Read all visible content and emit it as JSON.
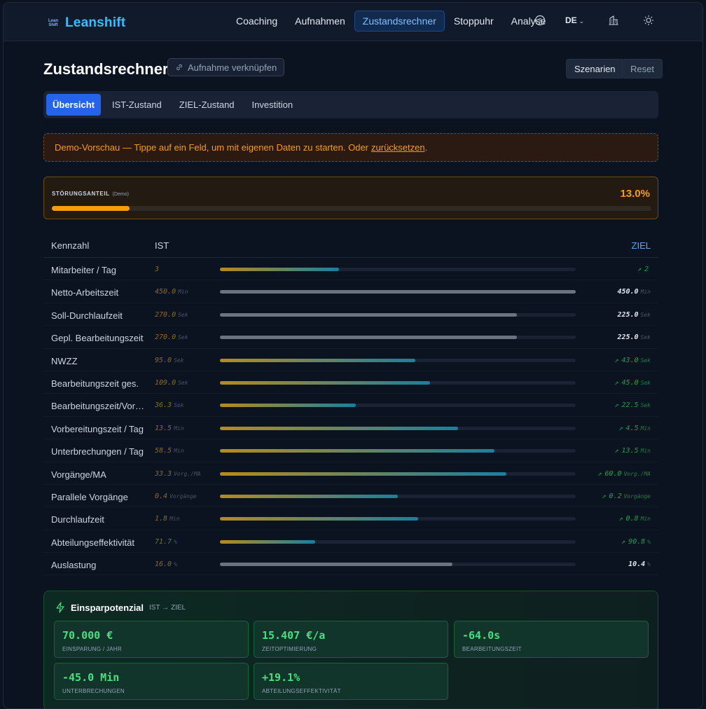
{
  "app": {
    "logo_mark_line1": "Lean",
    "logo_mark_line2": "Shift",
    "name": "Leanshift"
  },
  "nav": {
    "items": [
      "Coaching",
      "Aufnahmen",
      "Zustandsrechner",
      "Stoppuhr",
      "Analyse"
    ],
    "active": "Zustandsrechner",
    "lang": "DE"
  },
  "page": {
    "title": "Zustandsrechner",
    "link_button": "Aufnahme verknüpfen",
    "scenarios_button": "Szenarien",
    "reset_button": "Reset"
  },
  "tabs": [
    "Übersicht",
    "IST-Zustand",
    "ZIEL-Zustand",
    "Investition"
  ],
  "demo_notice": {
    "text": "Demo-Vorschau — Tippe auf ein Feld, um mit eigenen Daten zu starten. Oder",
    "link": "zurücksetzen",
    "suffix": "."
  },
  "stoerung": {
    "label": "STÖRUNGSANTEIL",
    "tag": "(Demo)",
    "value": "13.0%",
    "fraction": 0.13
  },
  "table": {
    "headers": {
      "kennzahl": "Kennzahl",
      "ist": "IST",
      "ziel": "ZIEL"
    },
    "rows": [
      {
        "label": "Mitarbeiter / Tag",
        "ist": "3",
        "ist_unit": "",
        "ziel": "2",
        "ziel_unit": "",
        "improved": true,
        "fill": 0.335
      },
      {
        "label": "Netto-Arbeitszeit",
        "ist": "450.0",
        "ist_unit": "Min",
        "ziel": "450.0",
        "ziel_unit": "Min",
        "improved": false,
        "fill": 1.0
      },
      {
        "label": "Soll-Durchlaufzeit",
        "ist": "270.0",
        "ist_unit": "Sek",
        "ziel": "225.0",
        "ziel_unit": "Sek",
        "improved": false,
        "fill": 0.835
      },
      {
        "label": "Gepl. Bearbeitungszeit",
        "ist": "270.0",
        "ist_unit": "Sek",
        "ziel": "225.0",
        "ziel_unit": "Sek",
        "improved": false,
        "fill": 0.835
      },
      {
        "label": "NWZZ",
        "ist": "95.0",
        "ist_unit": "Sek",
        "ziel": "43.0",
        "ziel_unit": "Sek",
        "improved": true,
        "fill": 0.55
      },
      {
        "label": "Bearbeitungszeit ges.",
        "ist": "109.0",
        "ist_unit": "Sek",
        "ziel": "45.0",
        "ziel_unit": "Sek",
        "improved": true,
        "fill": 0.59
      },
      {
        "label": "Bearbeitungszeit/Vorgang",
        "ist": "36.3",
        "ist_unit": "Sek",
        "ziel": "22.5",
        "ziel_unit": "Sek",
        "improved": true,
        "fill": 0.382
      },
      {
        "label": "Vorbereitungszeit / Tag",
        "ist": "13.5",
        "ist_unit": "Min",
        "ziel": "4.5",
        "ziel_unit": "Min",
        "improved": true,
        "fill": 0.67
      },
      {
        "label": "Unterbrechungen / Tag",
        "ist": "58.5",
        "ist_unit": "Min",
        "ziel": "13.5",
        "ziel_unit": "Min",
        "improved": true,
        "fill": 0.772
      },
      {
        "label": "Vorgänge/MA",
        "ist": "33.3",
        "ist_unit": "Vorg./MA",
        "ziel": "60.0",
        "ziel_unit": "Vorg./MA",
        "improved": true,
        "fill": 0.805
      },
      {
        "label": "Parallele Vorgänge",
        "ist": "0.4",
        "ist_unit": "Vorgänge",
        "ziel": "0.2",
        "ziel_unit": "Vorgänge",
        "improved": true,
        "fill": 0.5
      },
      {
        "label": "Durchlaufzeit",
        "ist": "1.8",
        "ist_unit": "Min",
        "ziel": "0.8",
        "ziel_unit": "Min",
        "improved": true,
        "fill": 0.557
      },
      {
        "label": "Abteilungseffektivität",
        "ist": "71.7",
        "ist_unit": "%",
        "ziel": "90.8",
        "ziel_unit": "%",
        "improved": true,
        "fill": 0.268
      },
      {
        "label": "Auslastung",
        "ist": "16.0",
        "ist_unit": "%",
        "ziel": "10.4",
        "ziel_unit": "%",
        "improved": false,
        "fill": 0.653
      }
    ]
  },
  "savings": {
    "title": "Einsparpotenzial",
    "subtitle": "IST → ZIEL",
    "cards": [
      {
        "value": "70.000 €",
        "label": "EINSPARUNG / JAHR"
      },
      {
        "value": "15.407 €/a",
        "label": "ZEITOPTIMIERUNG"
      },
      {
        "value": "-64.0s",
        "label": "BEARBEITUNGSZEIT"
      },
      {
        "value": "-45.0 Min",
        "label": "UNTERBRECHUNGEN"
      },
      {
        "value": "+19.1%",
        "label": "ABTEILUNGSEFFEKTIVITÄT"
      }
    ]
  }
}
